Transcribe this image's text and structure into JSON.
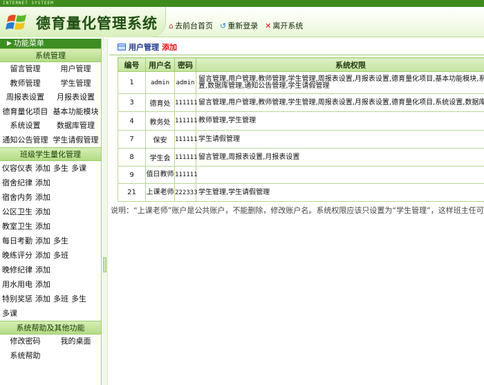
{
  "topbar": {
    "label": "INTERNET SYSTEEM"
  },
  "header": {
    "title": "德育量化管理系统",
    "links": [
      {
        "label": "去前台首页",
        "icon": "home-icon"
      },
      {
        "label": "重新登录",
        "icon": "relogin-icon"
      },
      {
        "label": "离开系统",
        "icon": "close-icon"
      }
    ]
  },
  "sidebar": {
    "menu_title": "功能菜单",
    "sections": [
      {
        "title": "系统管理",
        "items": [
          "留言管理",
          "用户管理",
          "教师管理",
          "学生管理",
          "周报表设置",
          "月报表设置",
          "德育量化项目",
          "基本功能模块",
          "系统设置",
          "数据库管理",
          "通知公告管理",
          "学生请假管理"
        ]
      },
      {
        "title": "班级学生量化管理",
        "rows": [
          [
            "仪容仪表",
            "添加",
            "多生",
            "多课"
          ],
          [
            "宿舍纪律",
            "添加"
          ],
          [
            "宿舍内务",
            "添加"
          ],
          [
            "公区卫生",
            "添加"
          ],
          [
            "教室卫生",
            "添加"
          ],
          [
            "每日考勤",
            "添加",
            "多生"
          ],
          [
            "晚练评分",
            "添加",
            "多班"
          ],
          [
            "晚修纪律",
            "添加"
          ],
          [
            "用水用电",
            "添加"
          ],
          [
            "特别奖惩",
            "添加",
            "多班",
            "多生"
          ],
          [
            "多课"
          ]
        ]
      },
      {
        "title": "系统帮助及其他功能",
        "items": [
          "修改密码",
          "我的桌面",
          "系统帮助"
        ]
      }
    ]
  },
  "main": {
    "panel_title": "用户管理",
    "add_label": "添加",
    "table": {
      "columns": [
        "编号",
        "用户名",
        "密码",
        "系统权限"
      ],
      "rows": [
        {
          "id": "1",
          "username": "admin",
          "password": "admin",
          "permissions": "留言管理,用户管理,教师管理,学生管理,周报表设置,月报表设置,德育量化项目,基本功能模块,系统设置,数据库管理,通知公告管理,学生请假管理"
        },
        {
          "id": "3",
          "username": "德育处",
          "password": "111111",
          "permissions": "留言管理,用户管理,教师管理,学生管理,周报表设置,月报表设置,德育量化项目,系统设置,数据库管理"
        },
        {
          "id": "4",
          "username": "教务处",
          "password": "111111",
          "permissions": "教师管理,学生管理"
        },
        {
          "id": "7",
          "username": "保安",
          "password": "111111",
          "permissions": "学生请假管理"
        },
        {
          "id": "8",
          "username": "学生会",
          "password": "111111",
          "permissions": "留言管理,周报表设置,月报表设置"
        },
        {
          "id": "9",
          "username": "值日教师",
          "password": "111111",
          "permissions": ""
        },
        {
          "id": "21",
          "username": "上课老师",
          "password": "222333",
          "permissions": "学生管理,学生请假管理"
        }
      ]
    },
    "note": "说明：“上课老师”账户是公共账户，不能删除，修改账户名。系统权限应该只设置为“学生管理”，这样班主任可以"
  },
  "colors": {
    "accent_green": "#3d8e21",
    "add_red": "#e01212",
    "title_green": "#1e4e10"
  }
}
